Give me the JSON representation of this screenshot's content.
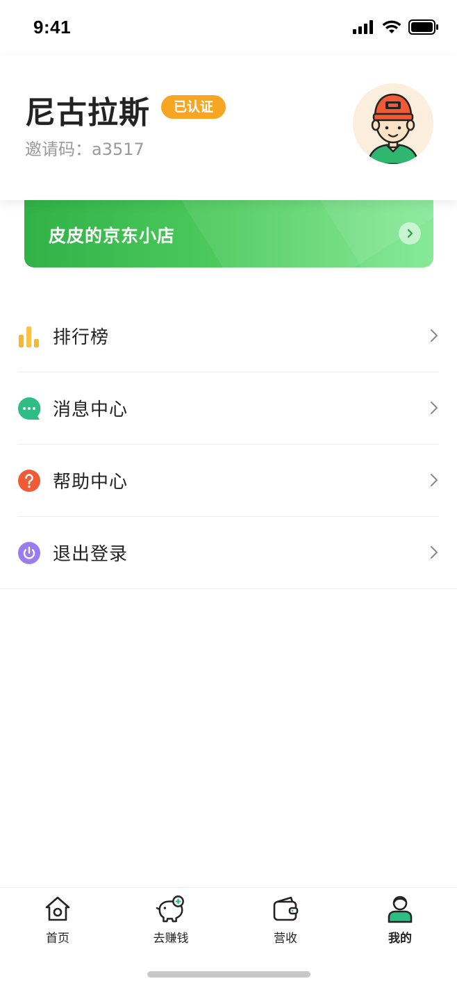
{
  "status_bar": {
    "time": "9:41"
  },
  "profile": {
    "name": "尼古拉斯",
    "badge": "已认证",
    "invite_label": "邀请码：",
    "invite_code": "a3517"
  },
  "shop": {
    "name": "皮皮的京东小店"
  },
  "menu": {
    "items": [
      {
        "label": "排行榜",
        "icon": "bar-chart-icon",
        "color": "#f7b733"
      },
      {
        "label": "消息中心",
        "icon": "chat-bubble-icon",
        "color": "#2ebd85"
      },
      {
        "label": "帮助中心",
        "icon": "question-icon",
        "color": "#f05a34"
      },
      {
        "label": "退出登录",
        "icon": "power-icon",
        "color": "#9b7cf0"
      }
    ]
  },
  "tabs": [
    {
      "label": "首页",
      "icon": "home-icon",
      "active": false
    },
    {
      "label": "去赚钱",
      "icon": "piggy-bank-icon",
      "active": false
    },
    {
      "label": "营收",
      "icon": "wallet-icon",
      "active": false
    },
    {
      "label": "我的",
      "icon": "user-icon",
      "active": true
    }
  ],
  "colors": {
    "accent_green": "#3bbf52",
    "badge_orange": "#f6a623"
  }
}
